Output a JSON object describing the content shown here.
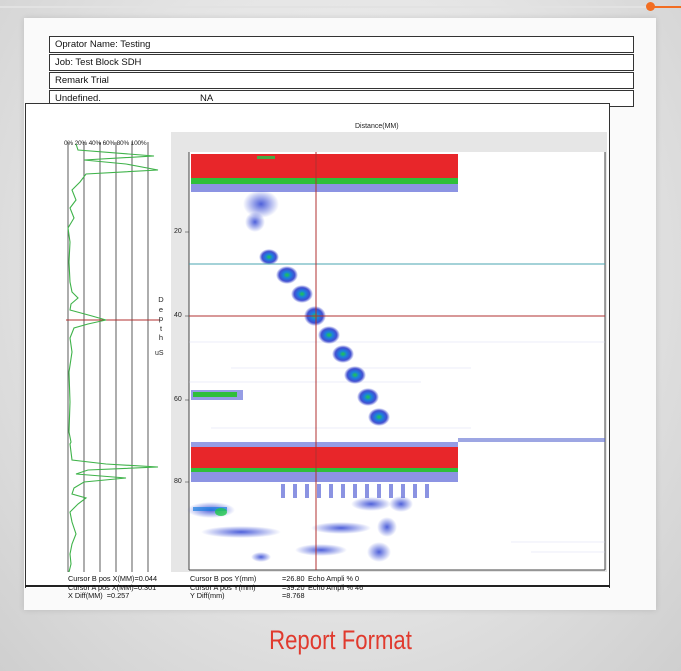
{
  "header": {
    "operator": "Oprator Name: Testing",
    "job": "Job: Test Block SDH",
    "remark": "Remark Trial",
    "undefined_label": "Undefined.",
    "undefined_value": "NA"
  },
  "amplitude_scale": "0% 20% 40% 60% 80% 100%",
  "depth_label": [
    "D",
    "e",
    "p",
    "t",
    "h"
  ],
  "depth_unit": "uS",
  "distance_title": "Distance(MM)",
  "depth_ticks": [
    "20",
    "40",
    "60",
    "80"
  ],
  "readouts": {
    "cursor_b_x": "Cursor B pos X(MM)=0.044",
    "cursor_a_x": "Cursor A pos X(MM)=0.301",
    "x_diff": "X Diff(MM)  =0.257",
    "cursor_b_y": "Cursor B pos Y(mm)",
    "cursor_a_y": "Cursor A pos Y(mm)",
    "y_diff": "Y Diff(mm)",
    "cursor_b_y_val": "=26.80",
    "cursor_a_y_val": "=39.20",
    "y_diff_val": "=8.768",
    "echo_b": "Echo Ampli % 0",
    "echo_a": "Echo Ampli % 46"
  },
  "caption": "Report Format",
  "colors": {
    "accent": "#f26d21",
    "caption": "#e03a2e",
    "echo_high": "#e8262a",
    "echo_mid": "#2fbf3a",
    "echo_low": "#2d3ccc",
    "cursor": "#b03030",
    "cursor_b": "#4aa6b0",
    "a_scan": "#3fb34a"
  }
}
